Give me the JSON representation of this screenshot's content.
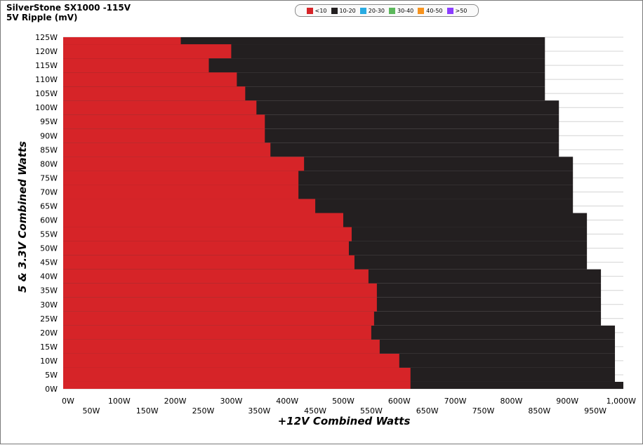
{
  "chart_data": {
    "type": "heatmap",
    "title": "SilverStone  SX1000 -115V",
    "subtitle": "5V Ripple (mV)",
    "xlabel": "+12V Combined Watts",
    "ylabel": "5 & 3.3V Combined Watts",
    "xlim": [
      0,
      1000
    ],
    "ylim": [
      0,
      125
    ],
    "x_ticks": [
      "0W",
      "50W",
      "100W",
      "150W",
      "200W",
      "250W",
      "300W",
      "350W",
      "400W",
      "450W",
      "500W",
      "550W",
      "600W",
      "650W",
      "700W",
      "750W",
      "800W",
      "850W",
      "900W",
      "950W",
      "1,000W"
    ],
    "y_ticks": [
      "0W",
      "5W",
      "10W",
      "15W",
      "20W",
      "25W",
      "30W",
      "35W",
      "40W",
      "45W",
      "50W",
      "55W",
      "60W",
      "65W",
      "70W",
      "75W",
      "80W",
      "85W",
      "90W",
      "95W",
      "100W",
      "105W",
      "110W",
      "115W",
      "120W",
      "125W"
    ],
    "legend": [
      {
        "label": "<10",
        "color": "#d62428"
      },
      {
        "label": "10-20",
        "color": "#231f20"
      },
      {
        "label": "20-30",
        "color": "#29abe2"
      },
      {
        "label": "30-40",
        "color": "#5cb85c"
      },
      {
        "label": "40-50",
        "color": "#f7931e"
      },
      {
        "label": ">50",
        "color": "#8b3dff"
      }
    ],
    "max_12v_by_5v": [
      [
        0,
        1000
      ],
      [
        5,
        985
      ],
      [
        10,
        985
      ],
      [
        15,
        985
      ],
      [
        20,
        985
      ],
      [
        25,
        960
      ],
      [
        30,
        960
      ],
      [
        35,
        960
      ],
      [
        40,
        960
      ],
      [
        45,
        935
      ],
      [
        50,
        935
      ],
      [
        55,
        935
      ],
      [
        60,
        935
      ],
      [
        65,
        910
      ],
      [
        70,
        910
      ],
      [
        75,
        910
      ],
      [
        80,
        910
      ],
      [
        85,
        885
      ],
      [
        90,
        885
      ],
      [
        95,
        885
      ],
      [
        100,
        885
      ],
      [
        105,
        860
      ],
      [
        110,
        860
      ],
      [
        115,
        860
      ],
      [
        120,
        860
      ],
      [
        125,
        860
      ]
    ],
    "lt10_boundary": [
      [
        0,
        620
      ],
      [
        5,
        620
      ],
      [
        10,
        600
      ],
      [
        15,
        565
      ],
      [
        20,
        550
      ],
      [
        25,
        555
      ],
      [
        30,
        560
      ],
      [
        35,
        560
      ],
      [
        40,
        545
      ],
      [
        45,
        520
      ],
      [
        50,
        510
      ],
      [
        55,
        515
      ],
      [
        60,
        500
      ],
      [
        65,
        450
      ],
      [
        70,
        420
      ],
      [
        75,
        420
      ],
      [
        80,
        430
      ],
      [
        85,
        370
      ],
      [
        90,
        360
      ],
      [
        95,
        360
      ],
      [
        100,
        345
      ],
      [
        105,
        325
      ],
      [
        110,
        310
      ],
      [
        115,
        260
      ],
      [
        120,
        300
      ],
      [
        125,
        210
      ]
    ]
  }
}
